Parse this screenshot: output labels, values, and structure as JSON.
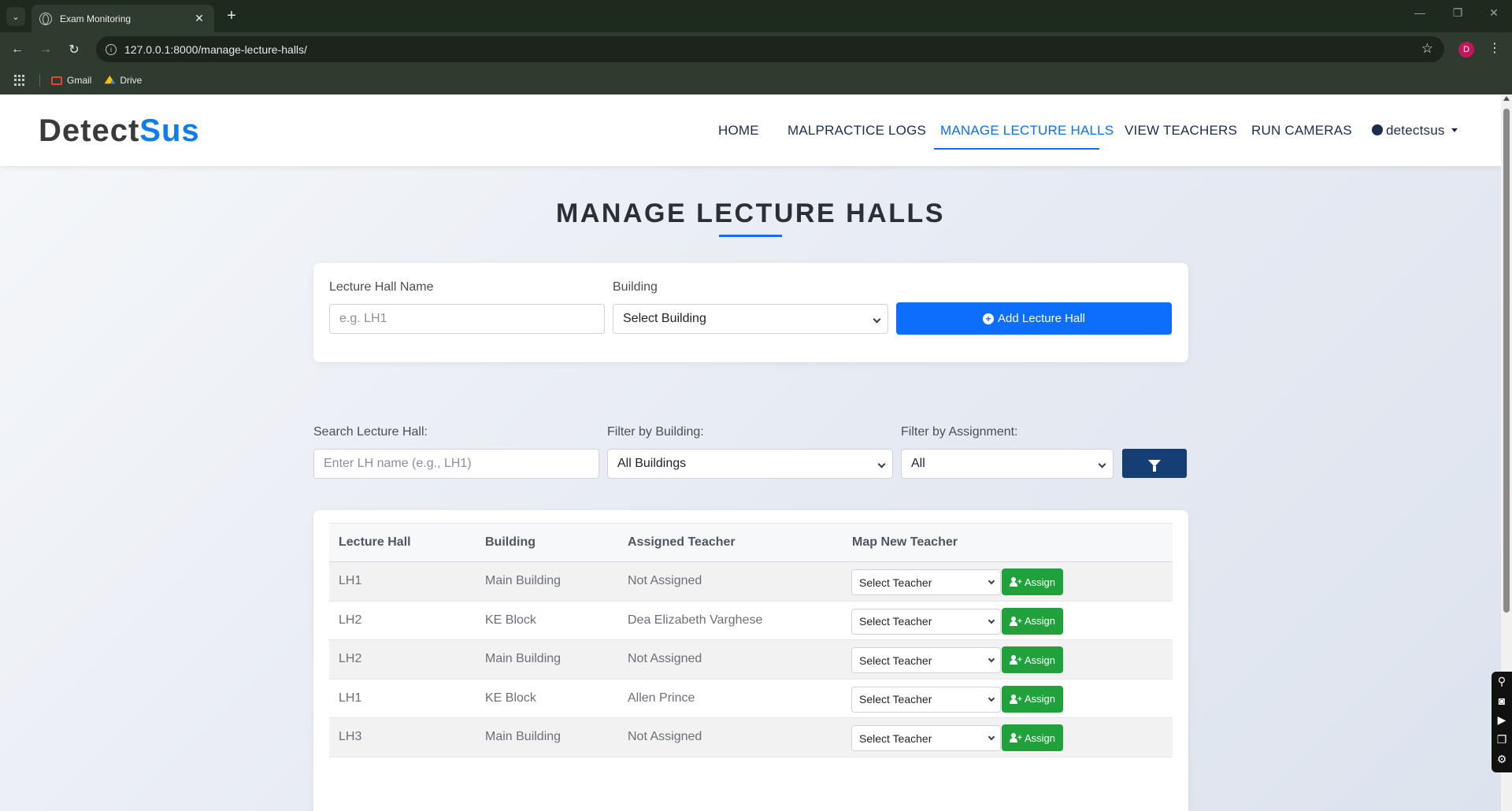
{
  "browser": {
    "tab_title": "Exam Monitoring",
    "url": "127.0.0.1:8000/manage-lecture-halls/",
    "profile_initial": "D",
    "bookmarks": [
      {
        "label": "Gmail",
        "icon": "gmail-icon"
      },
      {
        "label": "Drive",
        "icon": "drive-icon"
      }
    ]
  },
  "nav": {
    "brand_part1": "Detect",
    "brand_part2": "Sus",
    "items": [
      "HOME",
      "MALPRACTICE LOGS",
      "MANAGE LECTURE HALLS",
      "VIEW TEACHERS",
      "RUN CAMERAS"
    ],
    "active_item": "MANAGE LECTURE HALLS",
    "user": "detectsus"
  },
  "page": {
    "title": "MANAGE LECTURE HALLS"
  },
  "add_form": {
    "hall_name_label": "Lecture Hall Name",
    "hall_name_placeholder": "e.g. LH1",
    "building_label": "Building",
    "building_selected": "Select Building",
    "submit_label": "Add Lecture Hall"
  },
  "filters": {
    "search_label": "Search Lecture Hall:",
    "search_placeholder": "Enter LH name (e.g., LH1)",
    "building_label": "Filter by Building:",
    "building_selected": "All Buildings",
    "assignment_label": "Filter by Assignment:",
    "assignment_selected": "All"
  },
  "table": {
    "headers": [
      "Lecture Hall",
      "Building",
      "Assigned Teacher",
      "Map New Teacher"
    ],
    "rows": [
      {
        "hall": "LH1",
        "building": "Main Building",
        "teacher": "Not Assigned",
        "select": "Select Teacher",
        "action": "Assign"
      },
      {
        "hall": "LH2",
        "building": "KE Block",
        "teacher": "Dea Elizabeth Varghese",
        "select": "Select Teacher",
        "action": "Assign"
      },
      {
        "hall": "LH2",
        "building": "Main Building",
        "teacher": "Not Assigned",
        "select": "Select Teacher",
        "action": "Assign"
      },
      {
        "hall": "LH1",
        "building": "KE Block",
        "teacher": "Allen Prince",
        "select": "Select Teacher",
        "action": "Assign"
      },
      {
        "hall": "LH3",
        "building": "Main Building",
        "teacher": "Not Assigned",
        "select": "Select Teacher",
        "action": "Assign"
      }
    ]
  },
  "colors": {
    "primary": "#0d6efd",
    "assign_green": "#20a13c",
    "filter_navy": "#153e75",
    "brand_dark": "#3a3a3a"
  }
}
